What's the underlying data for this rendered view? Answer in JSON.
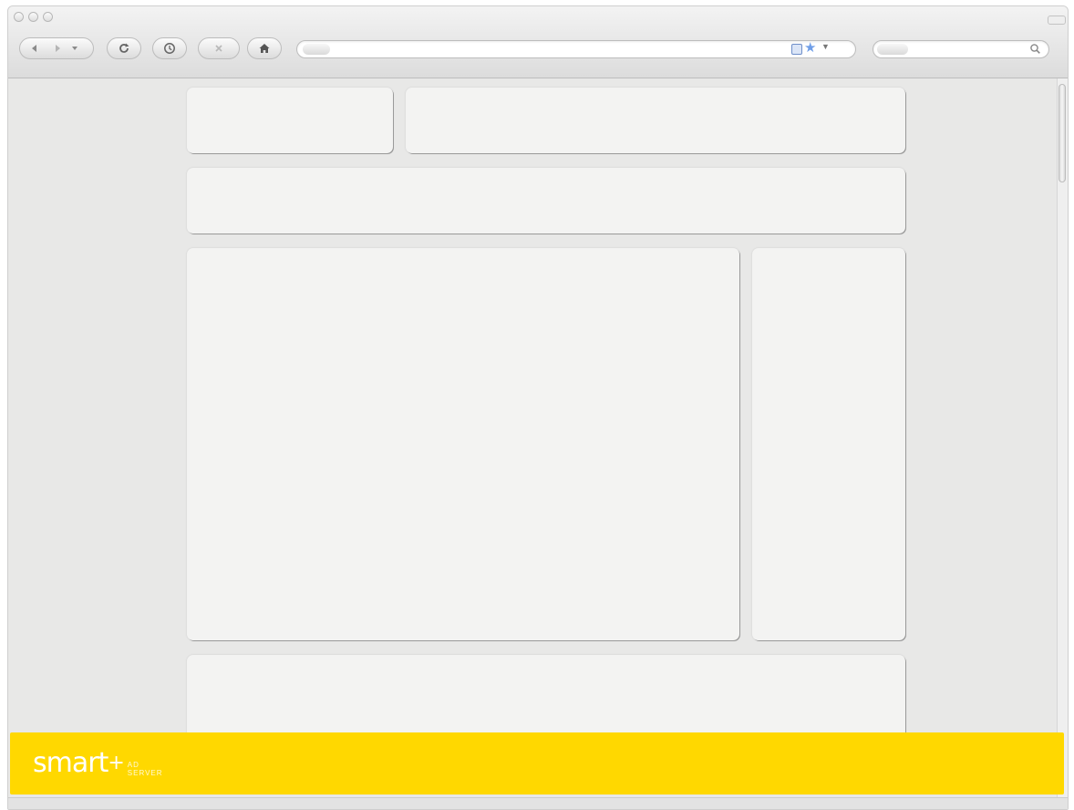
{
  "browser": {
    "toolbar": {
      "back_icon": "back-arrow-icon",
      "forward_icon": "forward-arrow-icon",
      "history_dropdown_icon": "chevron-down-icon",
      "reload_icon": "reload-icon",
      "history_icon": "clock-icon",
      "stop_icon": "close-icon",
      "home_icon": "home-icon"
    },
    "address_bar": {
      "value": "",
      "icons": [
        "rss-icon",
        "star-icon",
        "chevron-down-icon"
      ]
    },
    "search_bar": {
      "value": "",
      "icon": "magnifier-icon"
    }
  },
  "page": {
    "layout_placeholders": [
      "logo",
      "header",
      "navigation",
      "main-content",
      "sidebar",
      "footer"
    ]
  },
  "ad_banner": {
    "brand": "smart",
    "brand_mark": "+",
    "tagline": [
      "AD",
      "SERVER"
    ],
    "background": "#ffd800"
  }
}
